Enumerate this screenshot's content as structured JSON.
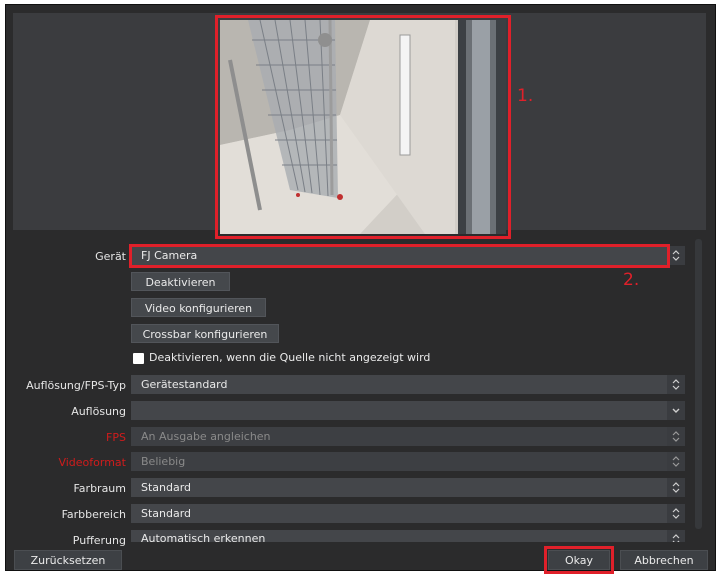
{
  "annotations": {
    "label_1": "1.",
    "label_2": "2."
  },
  "device": {
    "label": "Gerät",
    "value": "FJ Camera"
  },
  "buttons": {
    "deactivate": "Deaktivieren",
    "configure_video": "Video konfigurieren",
    "configure_crossbar": "Crossbar konfigurieren"
  },
  "checkbox": {
    "label": "Deaktivieren, wenn die Quelle nicht angezeigt wird",
    "checked": false
  },
  "settings": [
    {
      "label": "Auflösung/FPS-Typ",
      "value": "Gerätestandard",
      "control": "spin",
      "disabled": false,
      "label_color": "normal"
    },
    {
      "label": "Auflösung",
      "value": "",
      "control": "dropdown",
      "disabled": false,
      "label_color": "normal"
    },
    {
      "label": "FPS",
      "value": "An Ausgabe angleichen",
      "control": "spin",
      "disabled": true,
      "label_color": "red"
    },
    {
      "label": "Videoformat",
      "value": "Beliebig",
      "control": "spin",
      "disabled": true,
      "label_color": "red"
    },
    {
      "label": "Farbraum",
      "value": "Standard",
      "control": "spin",
      "disabled": false,
      "label_color": "normal"
    },
    {
      "label": "Farbbereich",
      "value": "Standard",
      "control": "spin",
      "disabled": false,
      "label_color": "normal"
    },
    {
      "label": "Pufferung",
      "value": "Automatisch erkennen",
      "control": "spin",
      "disabled": false,
      "label_color": "normal"
    }
  ],
  "footer": {
    "reset": "Zurücksetzen",
    "ok": "Okay",
    "cancel": "Abbrechen"
  },
  "colors": {
    "highlight": "#e0202a",
    "panel": "#2b2b2c",
    "field": "#44464a"
  }
}
